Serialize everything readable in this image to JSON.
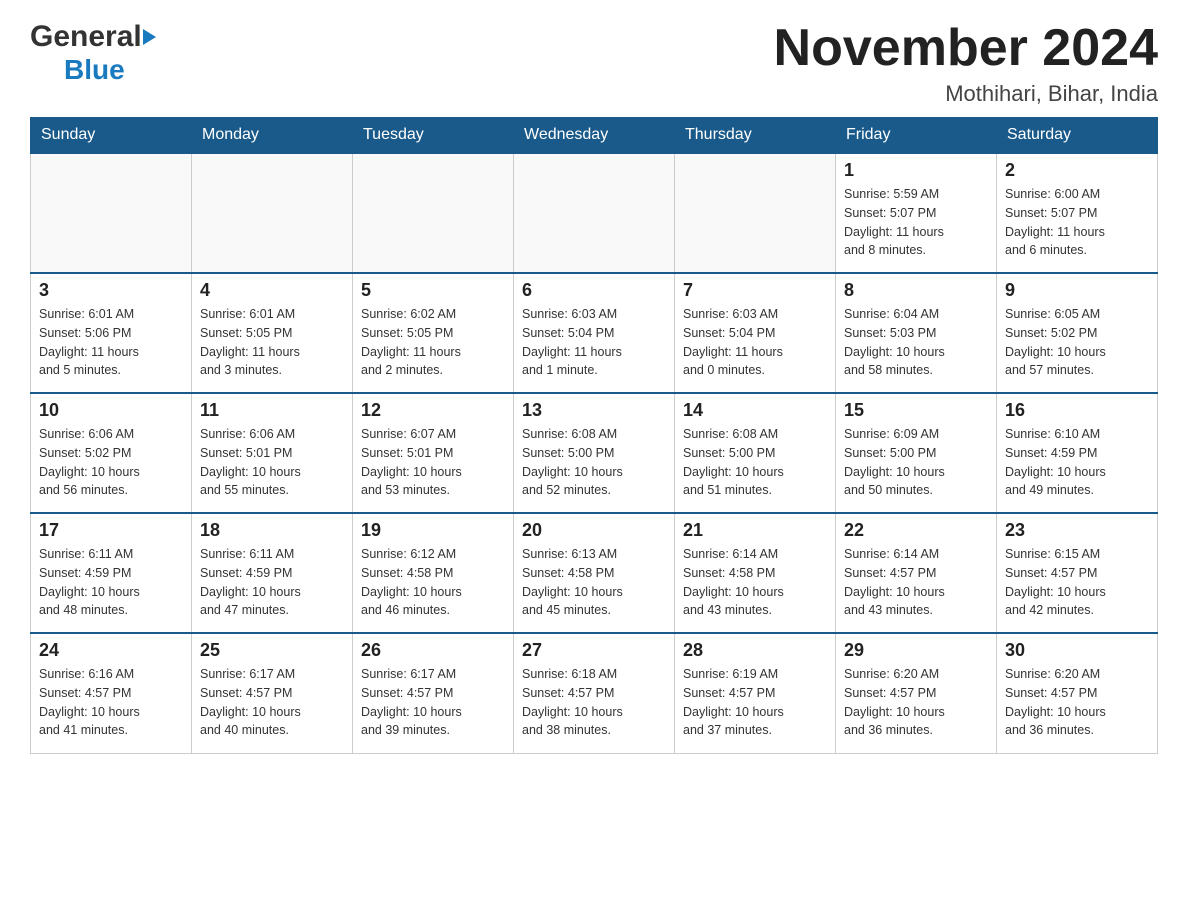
{
  "header": {
    "logo_general": "General",
    "logo_blue": "Blue",
    "month_title": "November 2024",
    "location": "Mothihari, Bihar, India"
  },
  "weekdays": [
    "Sunday",
    "Monday",
    "Tuesday",
    "Wednesday",
    "Thursday",
    "Friday",
    "Saturday"
  ],
  "weeks": [
    [
      {
        "day": "",
        "info": ""
      },
      {
        "day": "",
        "info": ""
      },
      {
        "day": "",
        "info": ""
      },
      {
        "day": "",
        "info": ""
      },
      {
        "day": "",
        "info": ""
      },
      {
        "day": "1",
        "info": "Sunrise: 5:59 AM\nSunset: 5:07 PM\nDaylight: 11 hours\nand 8 minutes."
      },
      {
        "day": "2",
        "info": "Sunrise: 6:00 AM\nSunset: 5:07 PM\nDaylight: 11 hours\nand 6 minutes."
      }
    ],
    [
      {
        "day": "3",
        "info": "Sunrise: 6:01 AM\nSunset: 5:06 PM\nDaylight: 11 hours\nand 5 minutes."
      },
      {
        "day": "4",
        "info": "Sunrise: 6:01 AM\nSunset: 5:05 PM\nDaylight: 11 hours\nand 3 minutes."
      },
      {
        "day": "5",
        "info": "Sunrise: 6:02 AM\nSunset: 5:05 PM\nDaylight: 11 hours\nand 2 minutes."
      },
      {
        "day": "6",
        "info": "Sunrise: 6:03 AM\nSunset: 5:04 PM\nDaylight: 11 hours\nand 1 minute."
      },
      {
        "day": "7",
        "info": "Sunrise: 6:03 AM\nSunset: 5:04 PM\nDaylight: 11 hours\nand 0 minutes."
      },
      {
        "day": "8",
        "info": "Sunrise: 6:04 AM\nSunset: 5:03 PM\nDaylight: 10 hours\nand 58 minutes."
      },
      {
        "day": "9",
        "info": "Sunrise: 6:05 AM\nSunset: 5:02 PM\nDaylight: 10 hours\nand 57 minutes."
      }
    ],
    [
      {
        "day": "10",
        "info": "Sunrise: 6:06 AM\nSunset: 5:02 PM\nDaylight: 10 hours\nand 56 minutes."
      },
      {
        "day": "11",
        "info": "Sunrise: 6:06 AM\nSunset: 5:01 PM\nDaylight: 10 hours\nand 55 minutes."
      },
      {
        "day": "12",
        "info": "Sunrise: 6:07 AM\nSunset: 5:01 PM\nDaylight: 10 hours\nand 53 minutes."
      },
      {
        "day": "13",
        "info": "Sunrise: 6:08 AM\nSunset: 5:00 PM\nDaylight: 10 hours\nand 52 minutes."
      },
      {
        "day": "14",
        "info": "Sunrise: 6:08 AM\nSunset: 5:00 PM\nDaylight: 10 hours\nand 51 minutes."
      },
      {
        "day": "15",
        "info": "Sunrise: 6:09 AM\nSunset: 5:00 PM\nDaylight: 10 hours\nand 50 minutes."
      },
      {
        "day": "16",
        "info": "Sunrise: 6:10 AM\nSunset: 4:59 PM\nDaylight: 10 hours\nand 49 minutes."
      }
    ],
    [
      {
        "day": "17",
        "info": "Sunrise: 6:11 AM\nSunset: 4:59 PM\nDaylight: 10 hours\nand 48 minutes."
      },
      {
        "day": "18",
        "info": "Sunrise: 6:11 AM\nSunset: 4:59 PM\nDaylight: 10 hours\nand 47 minutes."
      },
      {
        "day": "19",
        "info": "Sunrise: 6:12 AM\nSunset: 4:58 PM\nDaylight: 10 hours\nand 46 minutes."
      },
      {
        "day": "20",
        "info": "Sunrise: 6:13 AM\nSunset: 4:58 PM\nDaylight: 10 hours\nand 45 minutes."
      },
      {
        "day": "21",
        "info": "Sunrise: 6:14 AM\nSunset: 4:58 PM\nDaylight: 10 hours\nand 43 minutes."
      },
      {
        "day": "22",
        "info": "Sunrise: 6:14 AM\nSunset: 4:57 PM\nDaylight: 10 hours\nand 43 minutes."
      },
      {
        "day": "23",
        "info": "Sunrise: 6:15 AM\nSunset: 4:57 PM\nDaylight: 10 hours\nand 42 minutes."
      }
    ],
    [
      {
        "day": "24",
        "info": "Sunrise: 6:16 AM\nSunset: 4:57 PM\nDaylight: 10 hours\nand 41 minutes."
      },
      {
        "day": "25",
        "info": "Sunrise: 6:17 AM\nSunset: 4:57 PM\nDaylight: 10 hours\nand 40 minutes."
      },
      {
        "day": "26",
        "info": "Sunrise: 6:17 AM\nSunset: 4:57 PM\nDaylight: 10 hours\nand 39 minutes."
      },
      {
        "day": "27",
        "info": "Sunrise: 6:18 AM\nSunset: 4:57 PM\nDaylight: 10 hours\nand 38 minutes."
      },
      {
        "day": "28",
        "info": "Sunrise: 6:19 AM\nSunset: 4:57 PM\nDaylight: 10 hours\nand 37 minutes."
      },
      {
        "day": "29",
        "info": "Sunrise: 6:20 AM\nSunset: 4:57 PM\nDaylight: 10 hours\nand 36 minutes."
      },
      {
        "day": "30",
        "info": "Sunrise: 6:20 AM\nSunset: 4:57 PM\nDaylight: 10 hours\nand 36 minutes."
      }
    ]
  ]
}
